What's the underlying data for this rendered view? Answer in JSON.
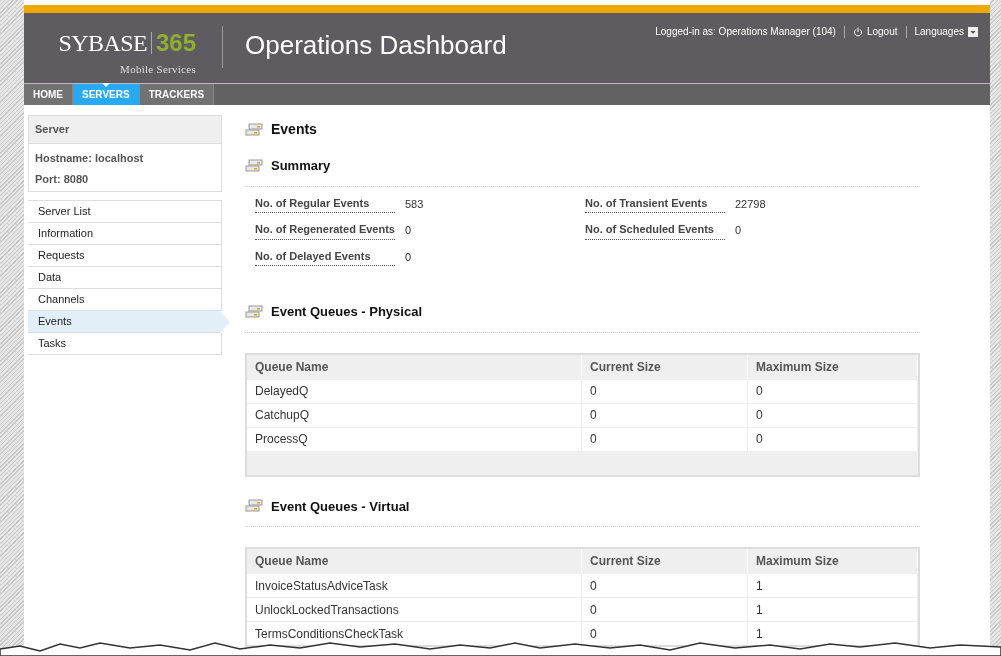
{
  "header": {
    "logo": {
      "brand": "SYBASE",
      "number": "365",
      "tagline": "Mobile Services"
    },
    "title": "Operations Dashboard",
    "user": "Logged-in as: Operations Manager (104)",
    "logout": "Logout",
    "languages": "Languages"
  },
  "tabs": [
    {
      "label": "HOME",
      "selected": false
    },
    {
      "label": "SERVERS",
      "selected": true
    },
    {
      "label": "TRACKERS",
      "selected": false
    }
  ],
  "sidebar": {
    "title": "Server",
    "hostname": "Hostname: localhost",
    "port": "Port: 8080",
    "items": [
      {
        "label": "Server List",
        "selected": false
      },
      {
        "label": "Information",
        "selected": false
      },
      {
        "label": "Requests",
        "selected": false
      },
      {
        "label": "Data",
        "selected": false
      },
      {
        "label": "Channels",
        "selected": false
      },
      {
        "label": "Events",
        "selected": true
      },
      {
        "label": "Tasks",
        "selected": false
      }
    ]
  },
  "page_title": "Events",
  "summary": {
    "title": "Summary",
    "fields": [
      {
        "label": "No. of Regular Events",
        "value": "583"
      },
      {
        "label": "No. of Transient Events",
        "value": "22798"
      },
      {
        "label": "No. of Regenerated Events",
        "value": "0"
      },
      {
        "label": "No. of Scheduled Events",
        "value": "0"
      },
      {
        "label": "No. of Delayed Events",
        "value": "0"
      }
    ]
  },
  "queues": [
    {
      "title": "Event Queues - Physical",
      "columns": [
        "Queue Name",
        "Current Size",
        "Maximum Size"
      ],
      "rows": [
        [
          "DelayedQ",
          "0",
          "0"
        ],
        [
          "CatchupQ",
          "0",
          "0"
        ],
        [
          "ProcessQ",
          "0",
          "0"
        ]
      ]
    },
    {
      "title": "Event Queues - Virtual",
      "columns": [
        "Queue Name",
        "Current Size",
        "Maximum Size"
      ],
      "rows": [
        [
          "InvoiceStatusAdviceTask",
          "0",
          "1"
        ],
        [
          "UnlockLockedTransactions",
          "0",
          "1"
        ],
        [
          "TermsConditionsCheckTask",
          "0",
          "1"
        ]
      ]
    }
  ]
}
